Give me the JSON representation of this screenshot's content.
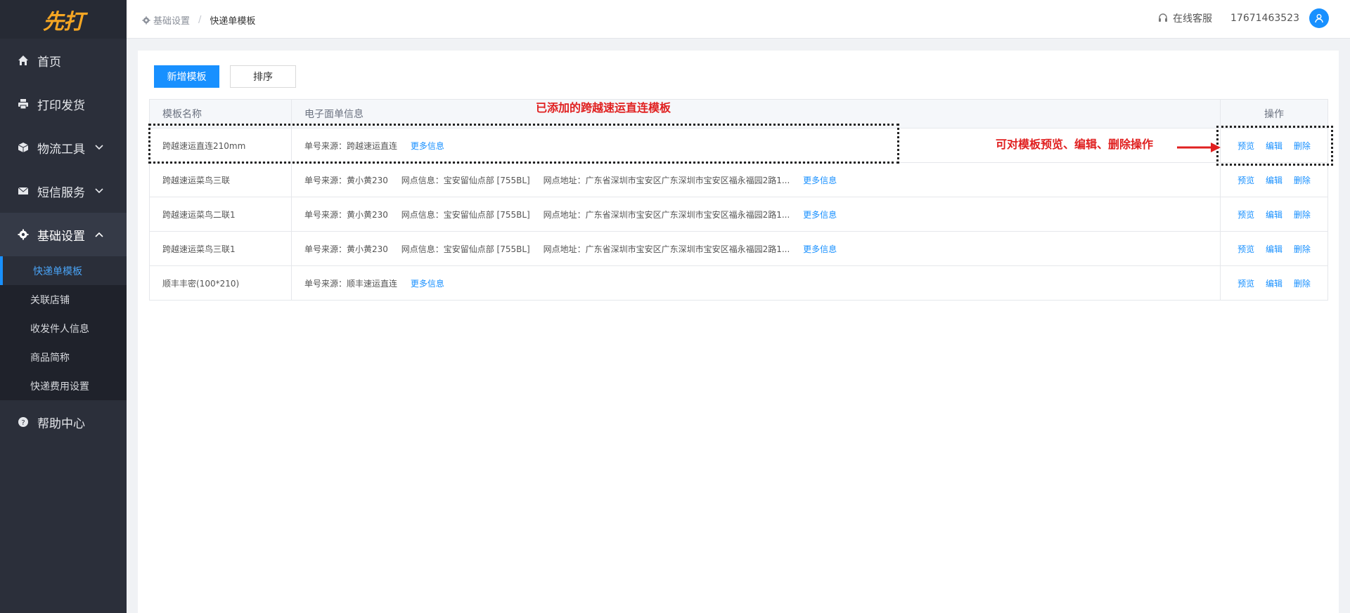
{
  "logo": "先打",
  "sidebar": {
    "items": [
      {
        "label": "首页"
      },
      {
        "label": "打印发货"
      },
      {
        "label": "物流工具"
      },
      {
        "label": "短信服务"
      },
      {
        "label": "基础设置"
      }
    ],
    "sub_items": [
      {
        "label": "快递单模板"
      },
      {
        "label": "关联店铺"
      },
      {
        "label": "收发件人信息"
      },
      {
        "label": "商品简称"
      },
      {
        "label": "快递费用设置"
      }
    ],
    "help": "帮助中心"
  },
  "header": {
    "breadcrumb_parent": "基础设置",
    "breadcrumb_sep": "/",
    "breadcrumb_current": "快递单模板",
    "service": "在线客服",
    "phone": "17671463523"
  },
  "toolbar": {
    "add_label": "新增模板",
    "sort_label": "排序"
  },
  "table": {
    "headers": {
      "name": "模板名称",
      "info": "电子面单信息",
      "ops": "操作"
    },
    "ops_labels": {
      "preview": "预览",
      "edit": "编辑",
      "delete": "删除"
    },
    "more": "更多信息",
    "rows": [
      {
        "name": "跨越速运直连210mm",
        "source": "单号来源：跨越速运直连",
        "outlet": "",
        "address": ""
      },
      {
        "name": "跨越速运菜鸟三联",
        "source": "单号来源：黄小黄230",
        "outlet": "网点信息：宝安留仙点部 [755BL]",
        "address": "网点地址：广东省深圳市宝安区广东深圳市宝安区福永福园2路1..."
      },
      {
        "name": "跨越速运菜鸟二联1",
        "source": "单号来源：黄小黄230",
        "outlet": "网点信息：宝安留仙点部 [755BL]",
        "address": "网点地址：广东省深圳市宝安区广东深圳市宝安区福永福园2路1..."
      },
      {
        "name": "跨越速运菜鸟三联1",
        "source": "单号来源：黄小黄230",
        "outlet": "网点信息：宝安留仙点部 [755BL]",
        "address": "网点地址：广东省深圳市宝安区广东深圳市宝安区福永福园2路1..."
      },
      {
        "name": "顺丰丰密(100*210)",
        "source": "单号来源：顺丰速运直连",
        "outlet": "",
        "address": ""
      }
    ]
  },
  "annotations": {
    "added": "已添加的跨越速运直连模板",
    "ops_hint": "可对模板预览、编辑、删除操作"
  }
}
